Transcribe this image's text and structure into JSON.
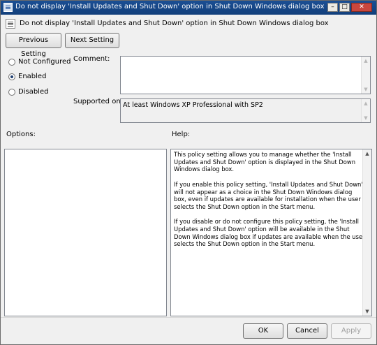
{
  "window": {
    "title": "Do not display 'Install Updates and Shut Down' option in Shut Down Windows dialog box",
    "controls": {
      "minimize": "–",
      "maximize": "□",
      "close": "✕"
    }
  },
  "header": {
    "icon": "policy-setting-icon",
    "text": "Do not display 'Install Updates and Shut Down' option in Shut Down Windows dialog box"
  },
  "nav": {
    "previous_label": "Previous Setting",
    "next_label": "Next Setting"
  },
  "state": {
    "options": [
      {
        "label": "Not Configured",
        "selected": false
      },
      {
        "label": "Enabled",
        "selected": true
      },
      {
        "label": "Disabled",
        "selected": false
      }
    ]
  },
  "comment": {
    "label": "Comment:",
    "value": ""
  },
  "supported": {
    "label": "Supported on:",
    "value": "At least Windows XP Professional with SP2"
  },
  "options_pane": {
    "label": "Options:"
  },
  "help_pane": {
    "label": "Help:",
    "paragraphs": [
      "This policy setting allows you to manage whether the 'Install Updates and Shut Down' option is displayed in the Shut Down Windows dialog box.",
      "If you enable this policy setting, 'Install Updates and Shut Down' will not appear as a choice in the Shut Down Windows dialog box, even if updates are available for installation when the user selects the Shut Down option in the Start menu.",
      "If you disable or do not configure this policy setting, the 'Install Updates and Shut Down' option will be available in the Shut Down Windows dialog box if updates are available when the user selects the Shut Down option in the Start menu."
    ]
  },
  "footer": {
    "ok_label": "OK",
    "cancel_label": "Cancel",
    "apply_label": "Apply"
  },
  "scroll_arrows": {
    "up": "▲",
    "down": "▼"
  }
}
